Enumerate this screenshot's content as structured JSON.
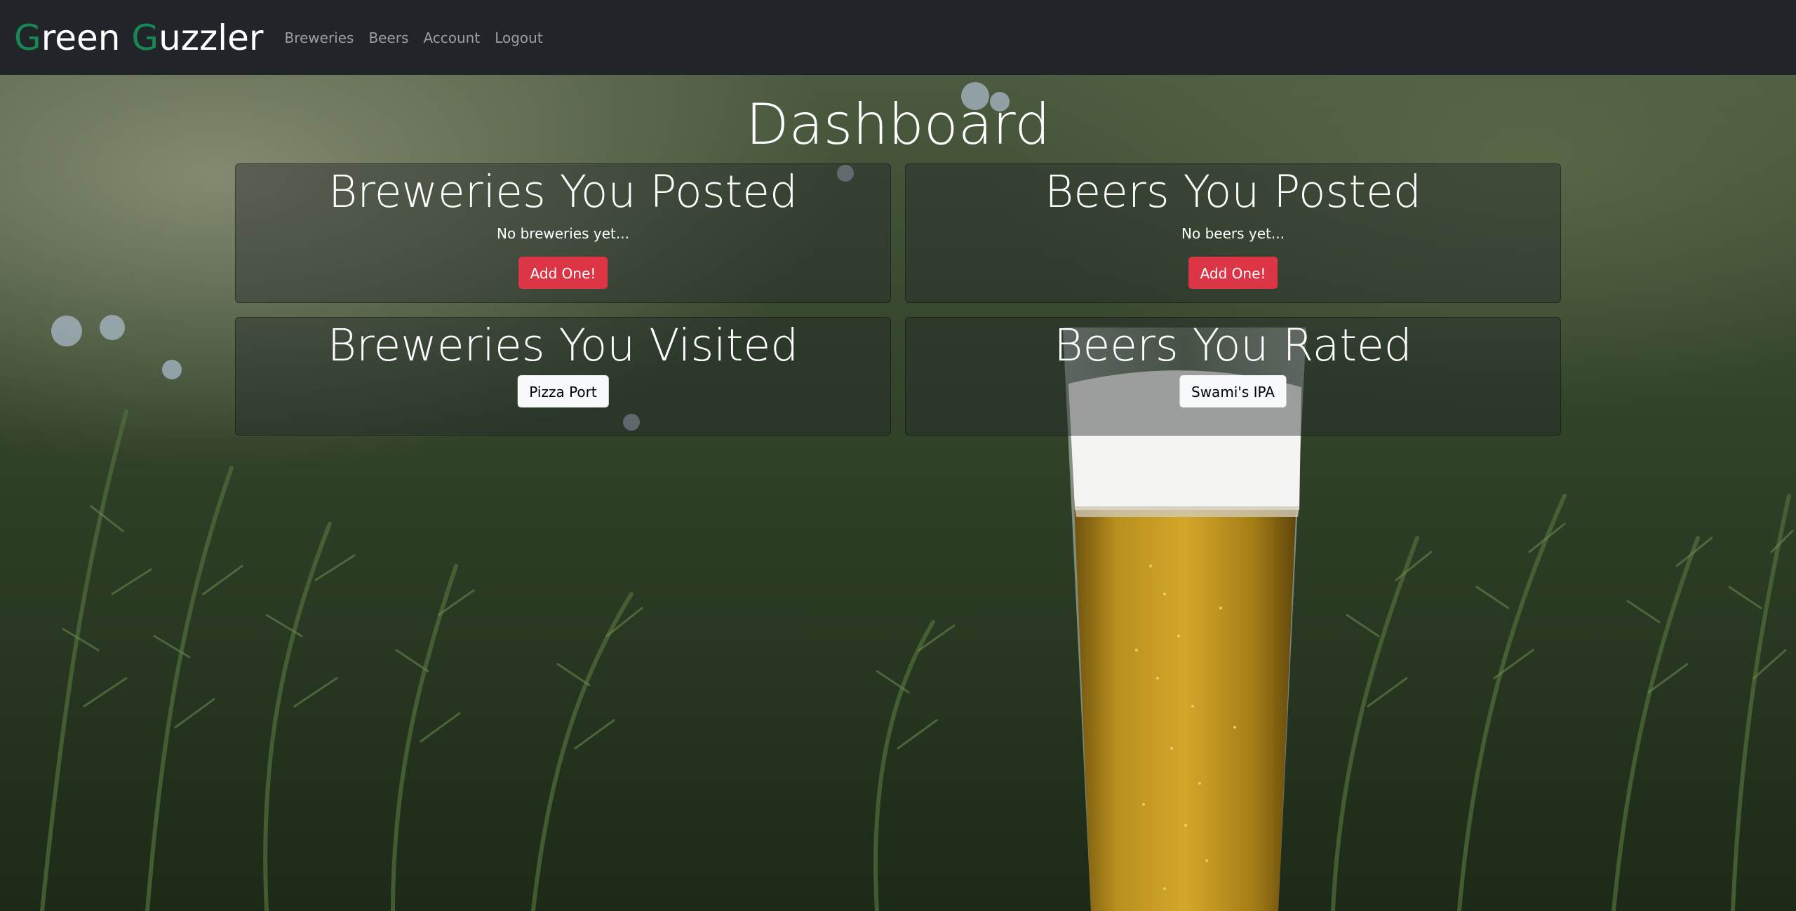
{
  "navbar": {
    "brand_g1": "G",
    "brand_rest1": "reen ",
    "brand_g2": "G",
    "brand_rest2": "uzzler",
    "brand_accent_color": "#198754",
    "links": [
      "Breweries",
      "Beers",
      "Account",
      "Logout"
    ]
  },
  "page": {
    "title": "Dashboard"
  },
  "cards": {
    "breweries_posted": {
      "title": "Breweries You Posted",
      "empty_text": "No breweries yet...",
      "button_label": "Add One!"
    },
    "beers_posted": {
      "title": "Beers You Posted",
      "empty_text": "No beers yet...",
      "button_label": "Add One!"
    },
    "breweries_visited": {
      "title": "Breweries You Visited",
      "items": [
        "Pizza Port"
      ]
    },
    "beers_rated": {
      "title": "Beers You Rated",
      "items": [
        "Swami's IPA"
      ]
    }
  },
  "colors": {
    "navbar_bg": "#212529",
    "button_danger": "#dc3545",
    "button_light": "#f8f9fa"
  }
}
